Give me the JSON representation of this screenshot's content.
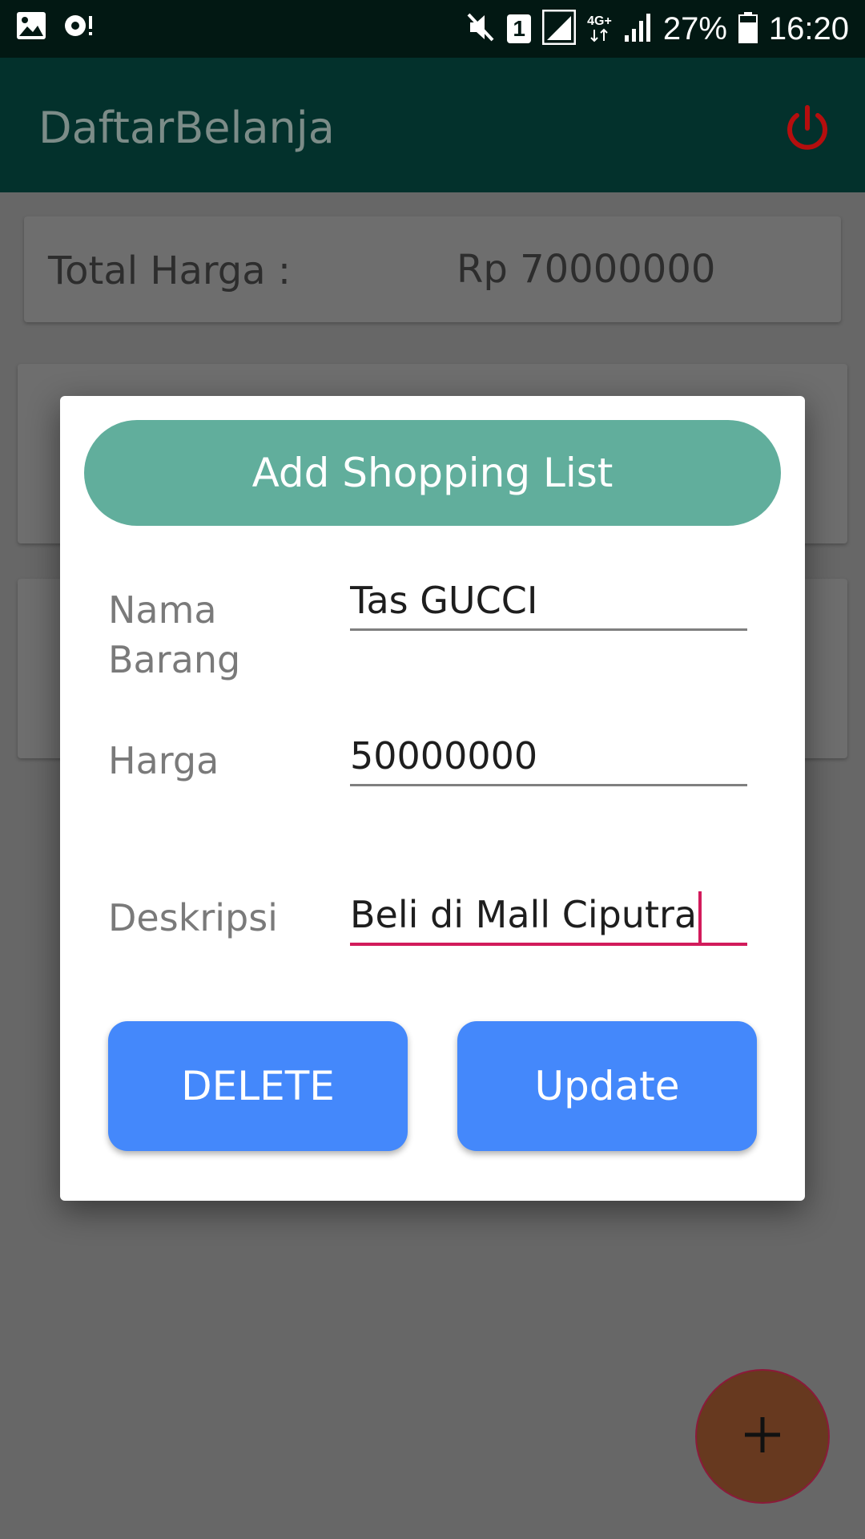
{
  "status_bar": {
    "time": "16:20",
    "battery": "27%",
    "sim_slot": "1",
    "network_type": "4G+",
    "icons": [
      "image-icon",
      "sync-alert-icon",
      "mute-icon",
      "sim-icon",
      "signal-icon",
      "data-arrows-icon",
      "signal-icon",
      "battery-icon"
    ]
  },
  "app_bar": {
    "title": "DaftarBelanja",
    "power_icon": "power-icon",
    "power_color": "#b50e0e"
  },
  "summary": {
    "total_label": "Total Harga :",
    "total_value": "Rp 70000000"
  },
  "dialog": {
    "title": "Add Shopping List",
    "fields": [
      {
        "label": "Nama\nBarang",
        "value": "Tas GUCCI"
      },
      {
        "label": "Harga",
        "value": "50000000"
      },
      {
        "label": "Deskripsi",
        "value": "Beli di Mall Ciputra"
      }
    ],
    "delete_label": "DELETE",
    "update_label": "Update"
  },
  "fab": {
    "icon": "plus-icon"
  },
  "colors": {
    "header_pill": "#61ae9c",
    "button": "#4488fb",
    "active_underline": "#d21b5b",
    "app_bar": "#03312c"
  }
}
